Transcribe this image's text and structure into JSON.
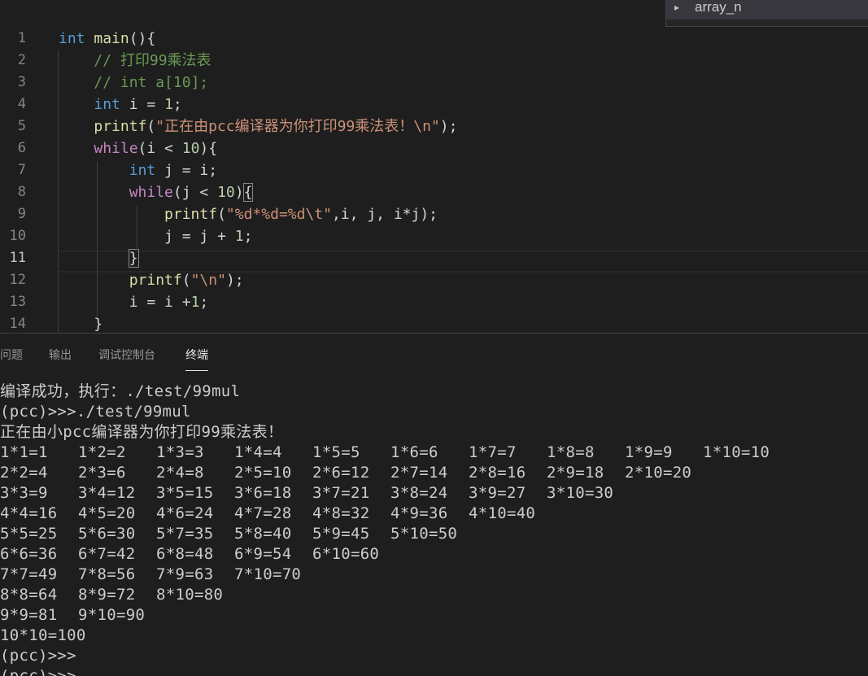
{
  "editor": {
    "line_numbers": [
      "1",
      "2",
      "3",
      "4",
      "5",
      "6",
      "7",
      "8",
      "9",
      "10",
      "11",
      "12",
      "13",
      "14"
    ],
    "active_line": "11",
    "code_lines": [
      [
        [
          "kw",
          "int"
        ],
        [
          "plain",
          " "
        ],
        [
          "fn",
          "main"
        ],
        [
          "plain",
          "(){"
        ]
      ],
      [
        [
          "plain",
          "    "
        ],
        [
          "cmt",
          "// 打印99乘法表"
        ]
      ],
      [
        [
          "plain",
          "    "
        ],
        [
          "cmt",
          "// int a[10];"
        ]
      ],
      [
        [
          "plain",
          "    "
        ],
        [
          "kw",
          "int"
        ],
        [
          "plain",
          " i = "
        ],
        [
          "num",
          "1"
        ],
        [
          "plain",
          ";"
        ]
      ],
      [
        [
          "plain",
          "    "
        ],
        [
          "fn",
          "printf"
        ],
        [
          "plain",
          "("
        ],
        [
          "str",
          "\"正在由pcc编译器为你打印99乘法表！\\n\""
        ],
        [
          "plain",
          ");"
        ]
      ],
      [
        [
          "plain",
          "    "
        ],
        [
          "ctl",
          "while"
        ],
        [
          "plain",
          "(i < "
        ],
        [
          "num",
          "10"
        ],
        [
          "plain",
          "){"
        ]
      ],
      [
        [
          "plain",
          "        "
        ],
        [
          "kw",
          "int"
        ],
        [
          "plain",
          " j = i;"
        ]
      ],
      [
        [
          "plain",
          "        "
        ],
        [
          "ctl",
          "while"
        ],
        [
          "plain",
          "(j < "
        ],
        [
          "num",
          "10"
        ],
        [
          "plain",
          ")"
        ],
        [
          "brk",
          "{"
        ]
      ],
      [
        [
          "plain",
          "            "
        ],
        [
          "fn",
          "printf"
        ],
        [
          "plain",
          "("
        ],
        [
          "str",
          "\"%d*%d=%d\\t\""
        ],
        [
          "plain",
          ",i, j, i*j);"
        ]
      ],
      [
        [
          "plain",
          "            j = j + "
        ],
        [
          "num",
          "1"
        ],
        [
          "plain",
          ";"
        ]
      ],
      [
        [
          "plain",
          "        "
        ],
        [
          "brk",
          "}"
        ]
      ],
      [
        [
          "plain",
          "        "
        ],
        [
          "fn",
          "printf"
        ],
        [
          "plain",
          "("
        ],
        [
          "str",
          "\"\\n\""
        ],
        [
          "plain",
          ");"
        ]
      ],
      [
        [
          "plain",
          "        i = i +"
        ],
        [
          "num",
          "1"
        ],
        [
          "plain",
          ";"
        ]
      ],
      [
        [
          "plain",
          "    }"
        ]
      ]
    ]
  },
  "outline": {
    "caret": "▸",
    "label": "array_n"
  },
  "panel": {
    "tabs": [
      {
        "label": "问题",
        "active": false
      },
      {
        "label": "输出",
        "active": false
      },
      {
        "label": "调试控制台",
        "active": false
      },
      {
        "label": "终端",
        "active": true
      }
    ],
    "terminal": {
      "header_lines": [
        "编译成功，执行：./test/99mul",
        "(pcc)>>>./test/99mul",
        "正在由小pcc编译器为你打印99乘法表！"
      ],
      "table_rows": [
        [
          "1*1=1",
          "1*2=2",
          "1*3=3",
          "1*4=4",
          "1*5=5",
          "1*6=6",
          "1*7=7",
          "1*8=8",
          "1*9=9",
          "1*10=10"
        ],
        [
          "2*2=4",
          "2*3=6",
          "2*4=8",
          "2*5=10",
          "2*6=12",
          "2*7=14",
          "2*8=16",
          "2*9=18",
          "2*10=20"
        ],
        [
          "3*3=9",
          "3*4=12",
          "3*5=15",
          "3*6=18",
          "3*7=21",
          "3*8=24",
          "3*9=27",
          "3*10=30"
        ],
        [
          "4*4=16",
          "4*5=20",
          "4*6=24",
          "4*7=28",
          "4*8=32",
          "4*9=36",
          "4*10=40"
        ],
        [
          "5*5=25",
          "5*6=30",
          "5*7=35",
          "5*8=40",
          "5*9=45",
          "5*10=50"
        ],
        [
          "6*6=36",
          "6*7=42",
          "6*8=48",
          "6*9=54",
          "6*10=60"
        ],
        [
          "7*7=49",
          "7*8=56",
          "7*9=63",
          "7*10=70"
        ],
        [
          "8*8=64",
          "8*9=72",
          "8*10=80"
        ],
        [
          "9*9=81",
          "9*10=90"
        ],
        [
          "10*10=100"
        ]
      ],
      "footer_lines": [
        "(pcc)>>>",
        "(pcc)>>>"
      ]
    }
  },
  "colors": {
    "background": "#1e1e1e",
    "keyword": "#569cd6",
    "control": "#c586c0",
    "function": "#dcdcaa",
    "string": "#ce9178",
    "comment": "#6a9955",
    "number": "#b5cea8"
  }
}
